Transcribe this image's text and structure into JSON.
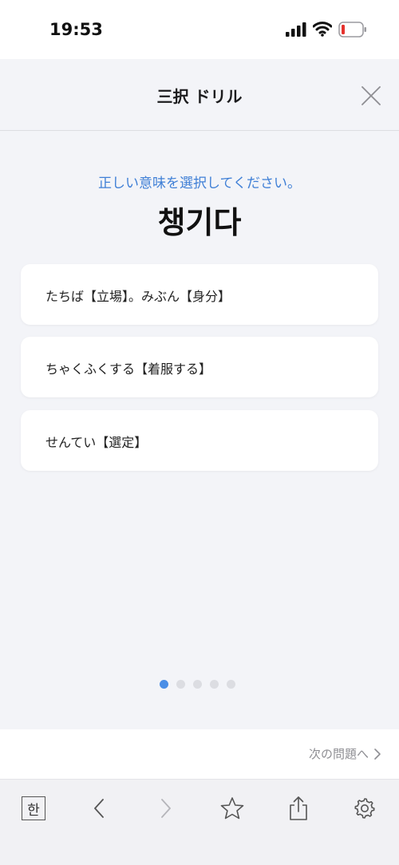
{
  "status": {
    "time": "19:53"
  },
  "header": {
    "title": "三択 ドリル",
    "close_icon": "close-icon"
  },
  "question": {
    "prompt": "正しい意味を選択してください。",
    "word": "챙기다"
  },
  "choices": [
    {
      "label": "たちば【立場】。みぶん【身分】"
    },
    {
      "label": "ちゃくふくする【着服する】"
    },
    {
      "label": "せんてい【選定】"
    }
  ],
  "pagination": {
    "total": 5,
    "current": 1
  },
  "next": {
    "label": "次の問題へ"
  },
  "toolbar": {
    "hangul_label": "한",
    "icons": [
      "hangul-icon",
      "back-icon",
      "forward-icon",
      "star-icon",
      "share-icon",
      "gear-icon"
    ]
  },
  "colors": {
    "accent": "#4a8ee6",
    "prompt": "#3f7fd6",
    "background": "#f3f4f8",
    "battery_low": "#e5322d"
  }
}
